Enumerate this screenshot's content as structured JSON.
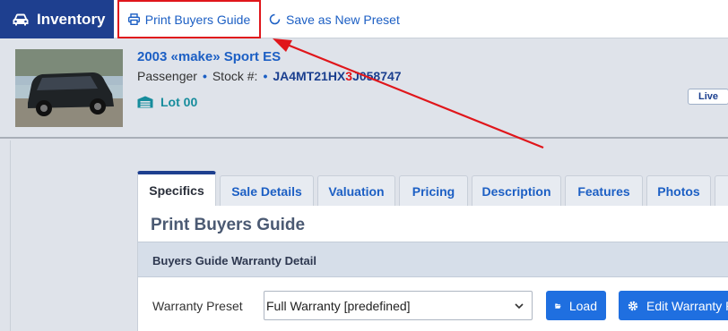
{
  "topbar": {
    "brand_label": "Inventory",
    "print_label": "Print Buyers Guide",
    "preset_label": "Save as New Preset"
  },
  "vehicle": {
    "title": "2003 «make» Sport ES",
    "type": "Passenger",
    "stock_label": "Stock #:",
    "vin_prefix": "JA4MT21HX",
    "vin_highlight": "3",
    "vin_suffix": "J058747",
    "lot": "Lot 00",
    "live_badge": "Live"
  },
  "tabs": [
    "Specifics",
    "Sale Details",
    "Valuation",
    "Pricing",
    "Description",
    "Features",
    "Photos"
  ],
  "panel": {
    "title": "Print Buyers Guide",
    "section": "Buyers Guide Warranty Detail",
    "warranty_label": "Warranty Preset",
    "warranty_value": "Full Warranty [predefined]",
    "load_label": "Load",
    "edit_label": "Edit Warranty P"
  },
  "colors": {
    "brand": "#1e3f8f",
    "link": "#1c5fc4",
    "highlight_box": "#e0161b",
    "button": "#1f6fe0"
  }
}
